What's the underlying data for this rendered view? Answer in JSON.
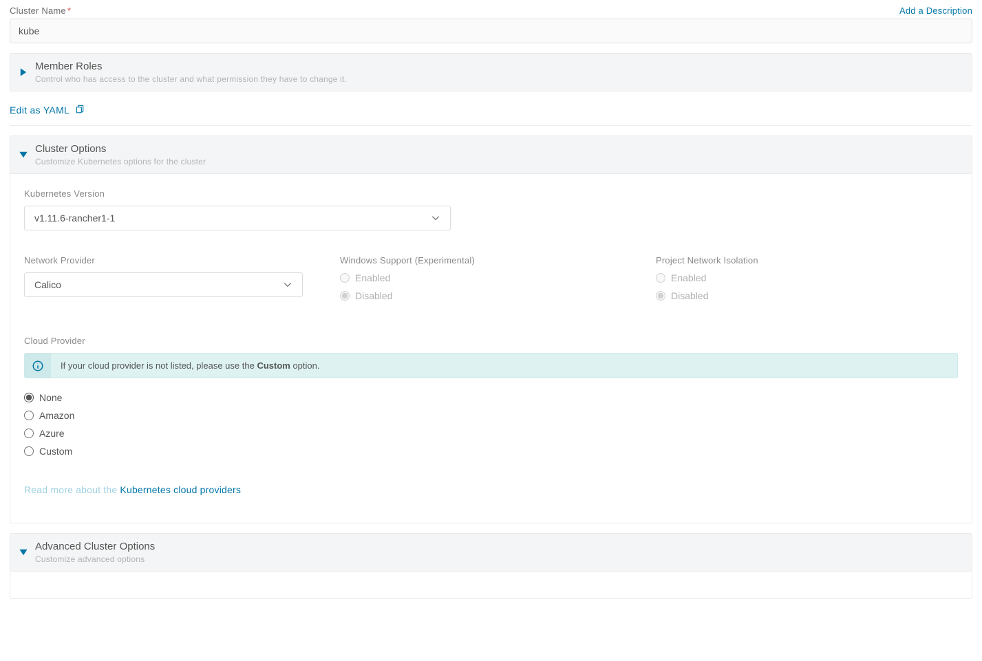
{
  "clusterName": {
    "label": "Cluster Name",
    "value": "kube"
  },
  "addDescription": "Add a Description",
  "memberRoles": {
    "title": "Member Roles",
    "subtitle": "Control who has access to the cluster and what permission they have to change it."
  },
  "editYaml": "Edit as YAML",
  "clusterOptions": {
    "title": "Cluster Options",
    "subtitle": "Customize Kubernetes options for the cluster",
    "k8sVersion": {
      "label": "Kubernetes Version",
      "value": "v1.11.6-rancher1-1"
    },
    "networkProvider": {
      "label": "Network Provider",
      "value": "Calico"
    },
    "windowsSupport": {
      "label": "Windows Support (Experimental)",
      "options": {
        "enabled": "Enabled",
        "disabled": "Disabled"
      },
      "selected": "disabled"
    },
    "projectIsolation": {
      "label": "Project Network Isolation",
      "options": {
        "enabled": "Enabled",
        "disabled": "Disabled"
      },
      "selected": "disabled"
    },
    "cloudProvider": {
      "label": "Cloud Provider",
      "bannerPrefix": "If your cloud provider is not listed, please use the ",
      "bannerBold": "Custom",
      "bannerSuffix": " option.",
      "options": {
        "none": "None",
        "amazon": "Amazon",
        "azure": "Azure",
        "custom": "Custom"
      },
      "selected": "none"
    },
    "readMore": {
      "prefix": "Read more about the ",
      "linkText": "Kubernetes cloud providers"
    }
  },
  "advanced": {
    "title": "Advanced Cluster Options",
    "subtitle": "Customize advanced options"
  }
}
